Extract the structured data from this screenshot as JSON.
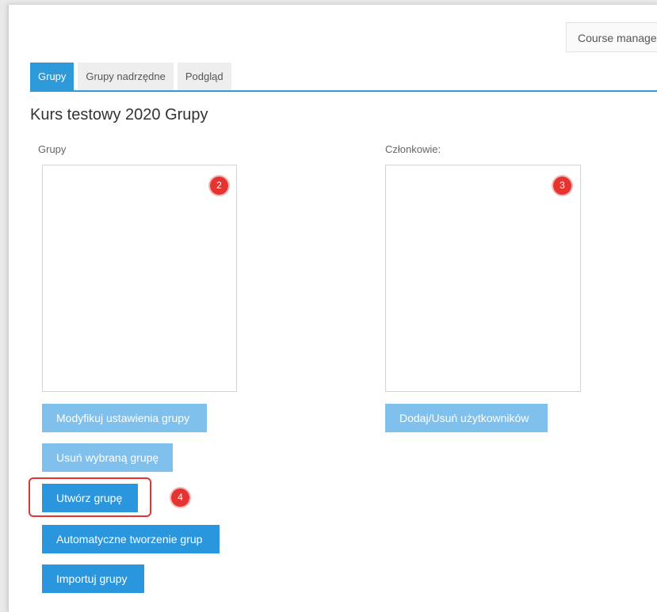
{
  "header": {
    "course_button": "Course manage"
  },
  "tabs": [
    {
      "label": "Grupy",
      "active": true
    },
    {
      "label": "Grupy nadrzędne",
      "active": false
    },
    {
      "label": "Podgląd",
      "active": false
    }
  ],
  "page_title": "Kurs testowy 2020 Grupy",
  "groups_panel": {
    "label": "Grupy",
    "marker": "2"
  },
  "members_panel": {
    "label": "Członkowie:",
    "marker": "3"
  },
  "buttons": {
    "modify_group": "Modyfikuj ustawienia grupy",
    "delete_group": "Usuń wybraną grupę",
    "create_group": "Utwórz grupę",
    "auto_create": "Automatyczne tworzenie grup",
    "import_groups": "Importuj grupy",
    "add_remove_users": "Dodaj/Usuń użytkowników"
  },
  "create_marker": "4",
  "colors": {
    "accent": "#2f9ad9",
    "accent_light": "#7fc1ec",
    "marker": "#e53430"
  }
}
